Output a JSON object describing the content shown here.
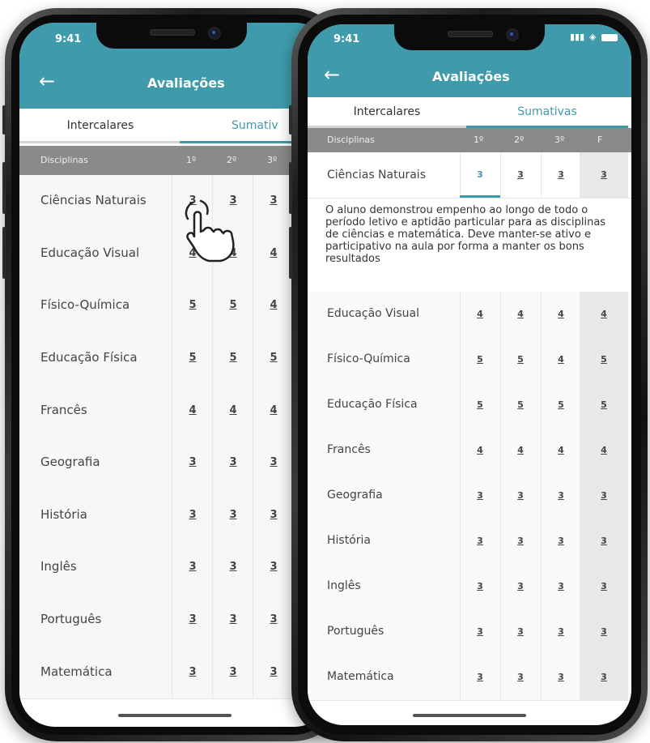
{
  "status": {
    "time": "9:41"
  },
  "header": {
    "back_icon": "arrow-left-icon",
    "title": "Avaliações"
  },
  "tabs": {
    "left": "Intercalares",
    "right": "Sumativas",
    "right_cut": "Sumativ"
  },
  "table_header": {
    "subject": "Disciplinas",
    "p1": "1º",
    "p2": "2º",
    "p3": "3º",
    "final": "F"
  },
  "colors": {
    "accent": "#3f9bab",
    "header_gray": "#8a8a8a",
    "selected": "#3f9bab"
  },
  "left_rows": [
    {
      "name": "Ciências Naturais",
      "g1": "3",
      "g2": "3",
      "g3": "3"
    },
    {
      "name": "Educação Visual",
      "g1": "4",
      "g2": "4",
      "g3": "4"
    },
    {
      "name": "Físico-Química",
      "g1": "5",
      "g2": "5",
      "g3": "4"
    },
    {
      "name": "Educação Física",
      "g1": "5",
      "g2": "5",
      "g3": "5"
    },
    {
      "name": "Francês",
      "g1": "4",
      "g2": "4",
      "g3": "4"
    },
    {
      "name": "Geografia",
      "g1": "3",
      "g2": "3",
      "g3": "3"
    },
    {
      "name": "História",
      "g1": "3",
      "g2": "3",
      "g3": "3"
    },
    {
      "name": "Inglês",
      "g1": "3",
      "g2": "3",
      "g3": "3"
    },
    {
      "name": "Português",
      "g1": "3",
      "g2": "3",
      "g3": "3"
    },
    {
      "name": "Matemática",
      "g1": "3",
      "g2": "3",
      "g3": "3"
    }
  ],
  "right_selected": {
    "name": "Ciências Naturais",
    "g1": "3",
    "g2": "3",
    "g3": "3",
    "f": "3"
  },
  "right_comment": "O aluno demonstrou empenho ao longo de todo o período letivo e aptidão particular para as disciplinas de ciências e matemática. Deve manter-se ativo e participativo na aula por forma a manter os bons resultados",
  "right_rows": [
    {
      "name": "Educação Visual",
      "g1": "4",
      "g2": "4",
      "g3": "4",
      "f": "4"
    },
    {
      "name": "Físico-Química",
      "g1": "5",
      "g2": "5",
      "g3": "4",
      "f": "5"
    },
    {
      "name": "Educação Física",
      "g1": "5",
      "g2": "5",
      "g3": "5",
      "f": "5"
    },
    {
      "name": "Francês",
      "g1": "4",
      "g2": "4",
      "g3": "4",
      "f": "4"
    },
    {
      "name": "Geografia",
      "g1": "3",
      "g2": "3",
      "g3": "3",
      "f": "3"
    },
    {
      "name": "História",
      "g1": "3",
      "g2": "3",
      "g3": "3",
      "f": "3"
    },
    {
      "name": "Inglês",
      "g1": "3",
      "g2": "3",
      "g3": "3",
      "f": "3"
    },
    {
      "name": "Português",
      "g1": "3",
      "g2": "3",
      "g3": "3",
      "f": "3"
    },
    {
      "name": "Matemática",
      "g1": "3",
      "g2": "3",
      "g3": "3",
      "f": "3"
    }
  ]
}
